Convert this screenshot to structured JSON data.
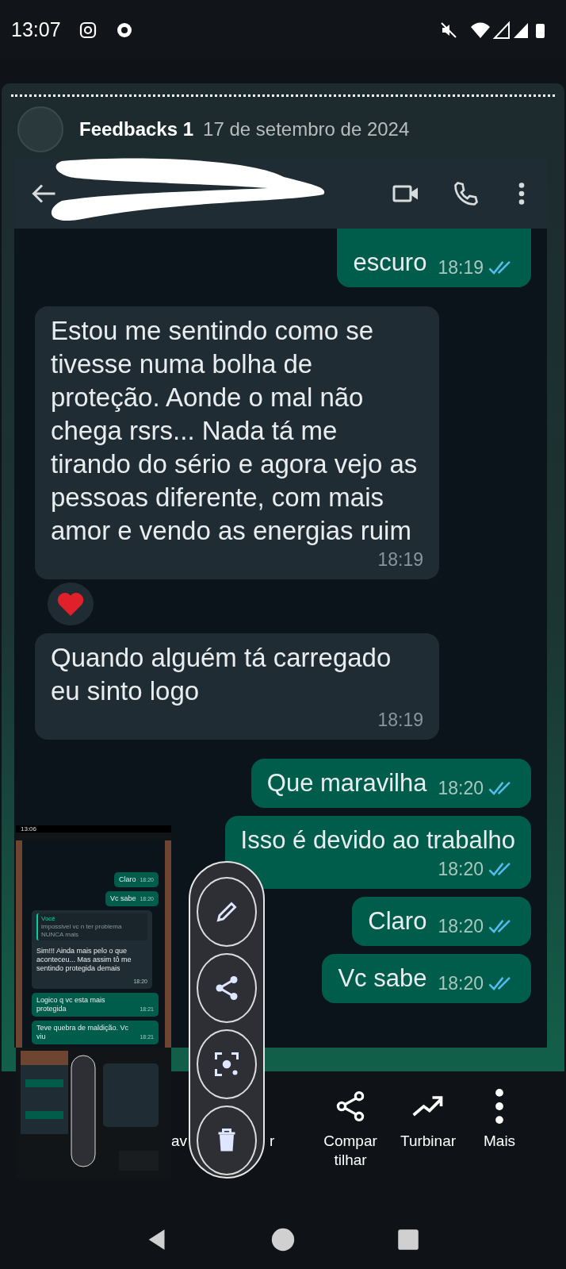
{
  "status_bar": {
    "time": "13:07"
  },
  "post": {
    "title": "Feedbacks 1",
    "date": "17 de setembro de 2024"
  },
  "messages": [
    {
      "kind": "outgoing",
      "text": "escuro",
      "time": "18:19",
      "reacted": false
    },
    {
      "kind": "incoming",
      "text": "Estou me sentindo como se tivesse numa bolha de proteção. Aonde o mal não chega rsrs... Nada tá me tirando do sério e agora vejo as pessoas diferente, com mais amor e vendo as energias ruim",
      "time": "18:19",
      "reacted": true
    },
    {
      "kind": "incoming",
      "text": "Quando alguém tá carregado eu sinto logo",
      "time": "18:19",
      "reacted": false
    },
    {
      "kind": "outgoing",
      "text": "Que maravilha",
      "time": "18:20",
      "reacted": false
    },
    {
      "kind": "outgoing",
      "text": "Isso é devido ao trabalho",
      "time": "18:20",
      "reacted": false
    },
    {
      "kind": "outgoing",
      "text": "Claro",
      "time": "18:20",
      "reacted": false
    },
    {
      "kind": "outgoing",
      "text": "Vc sabe",
      "time": "18:20",
      "reacted": false
    }
  ],
  "thumbnail": {
    "time": "13:06",
    "messages": [
      {
        "kind": "outgoing",
        "text": "Claro",
        "time": "18:20"
      },
      {
        "kind": "outgoing",
        "text": "Vc sabe",
        "time": "18:20"
      },
      {
        "kind": "reply",
        "quote_author": "Você",
        "quote": "impossivel vc n ter problema NUNCA mais",
        "text": "Sim!!! Ainda mais pelo o que aconteceu... Mas assim tô me sentindo protegida demais",
        "time": "18:20"
      },
      {
        "kind": "outgoing",
        "text": "Logico q vc esta mais protegida",
        "time": "18:21"
      },
      {
        "kind": "outgoing",
        "text": "Teve quebra de maldição. Vc viu",
        "time": "18:21"
      }
    ]
  },
  "tools": [
    {
      "kind": "edit"
    },
    {
      "kind": "share"
    },
    {
      "kind": "scan"
    },
    {
      "kind": "delete"
    }
  ],
  "actions": [
    {
      "kind": "partial",
      "label": "av"
    },
    {
      "kind": "partial",
      "label": "r"
    },
    {
      "kind": "share",
      "label": "Compar tilhar"
    },
    {
      "kind": "boost",
      "label": "Turbinar"
    },
    {
      "kind": "more",
      "label": "Mais"
    }
  ]
}
